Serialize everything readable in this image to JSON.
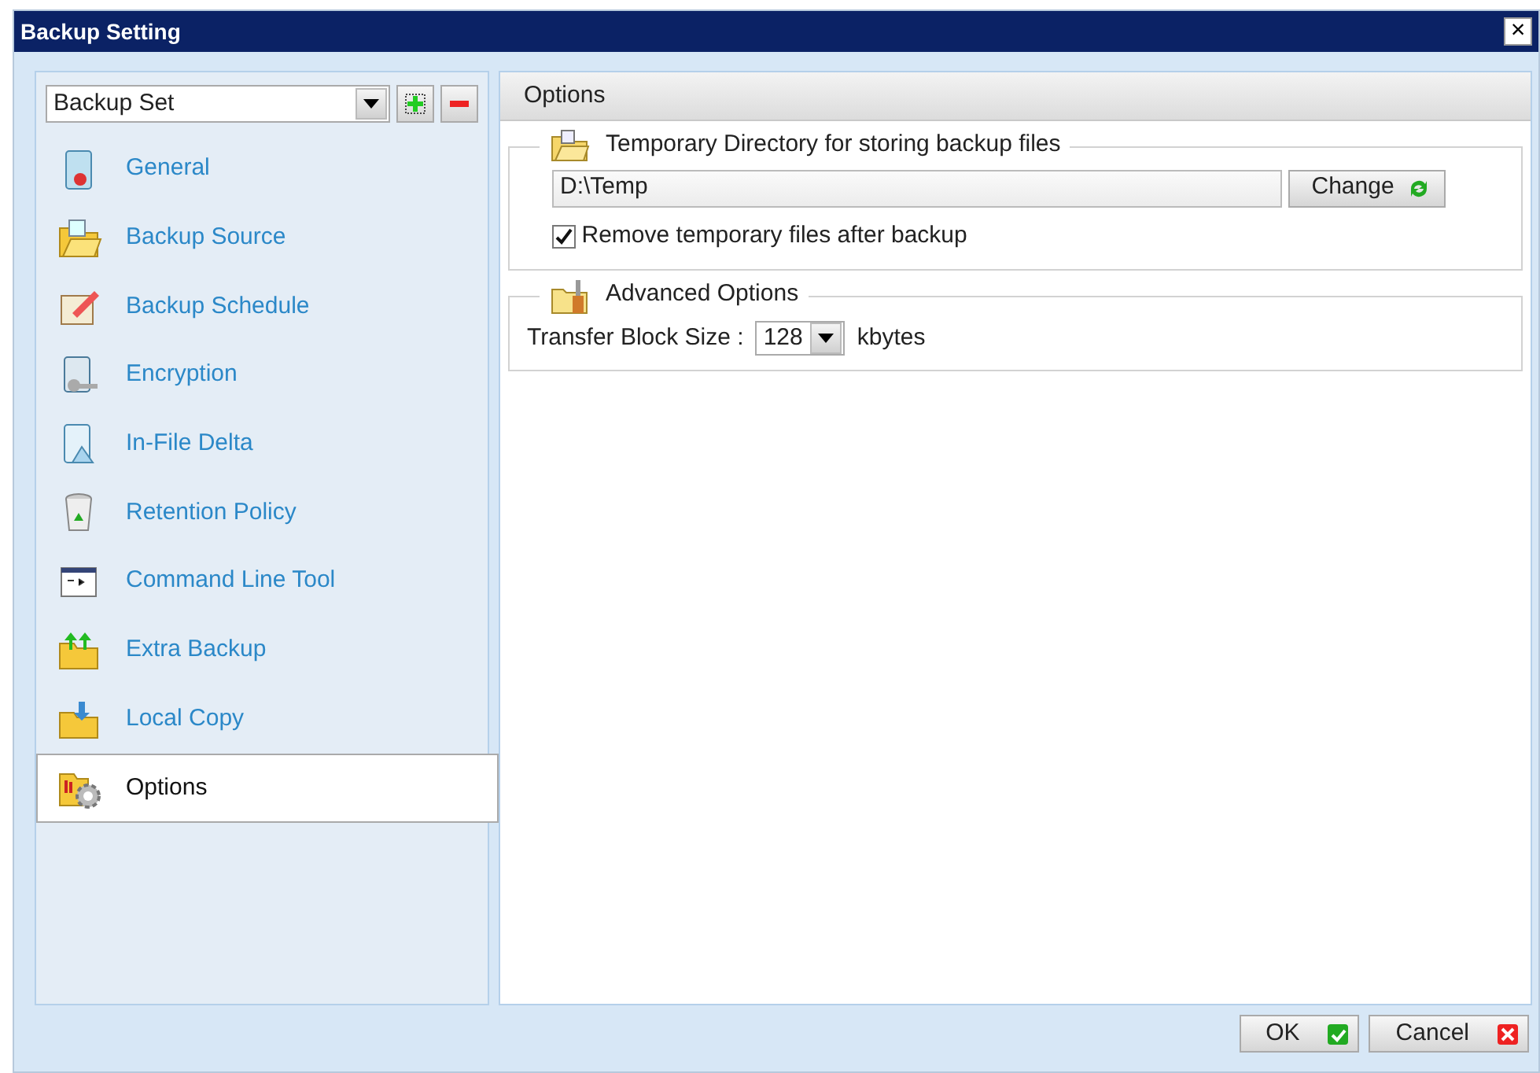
{
  "window": {
    "title": "Backup Setting",
    "close": "×"
  },
  "sidebar": {
    "backup_set": {
      "value": "Backup Set"
    },
    "items": [
      {
        "label": "General",
        "selected": false
      },
      {
        "label": "Backup Source",
        "selected": false
      },
      {
        "label": "Backup Schedule",
        "selected": false
      },
      {
        "label": "Encryption",
        "selected": false
      },
      {
        "label": "In-File Delta",
        "selected": false
      },
      {
        "label": "Retention Policy",
        "selected": false
      },
      {
        "label": "Command Line Tool",
        "selected": false
      },
      {
        "label": "Extra Backup",
        "selected": false
      },
      {
        "label": "Local Copy",
        "selected": false
      },
      {
        "label": "Options",
        "selected": true
      }
    ]
  },
  "panel": {
    "title": "Options",
    "temp_dir": {
      "legend": "Temporary Directory for storing backup files",
      "path": "D:\\Temp",
      "change_button": "Change",
      "remove_temp": {
        "label": "Remove temporary files after backup",
        "checked": true
      }
    },
    "advanced": {
      "legend": "Advanced Options",
      "block_size_label": "Transfer Block Size :",
      "block_size": "128",
      "unit": "kbytes"
    }
  },
  "buttons": [
    {
      "label": "OK",
      "kind": "ok"
    },
    {
      "label": "Cancel",
      "kind": "cancel"
    }
  ]
}
